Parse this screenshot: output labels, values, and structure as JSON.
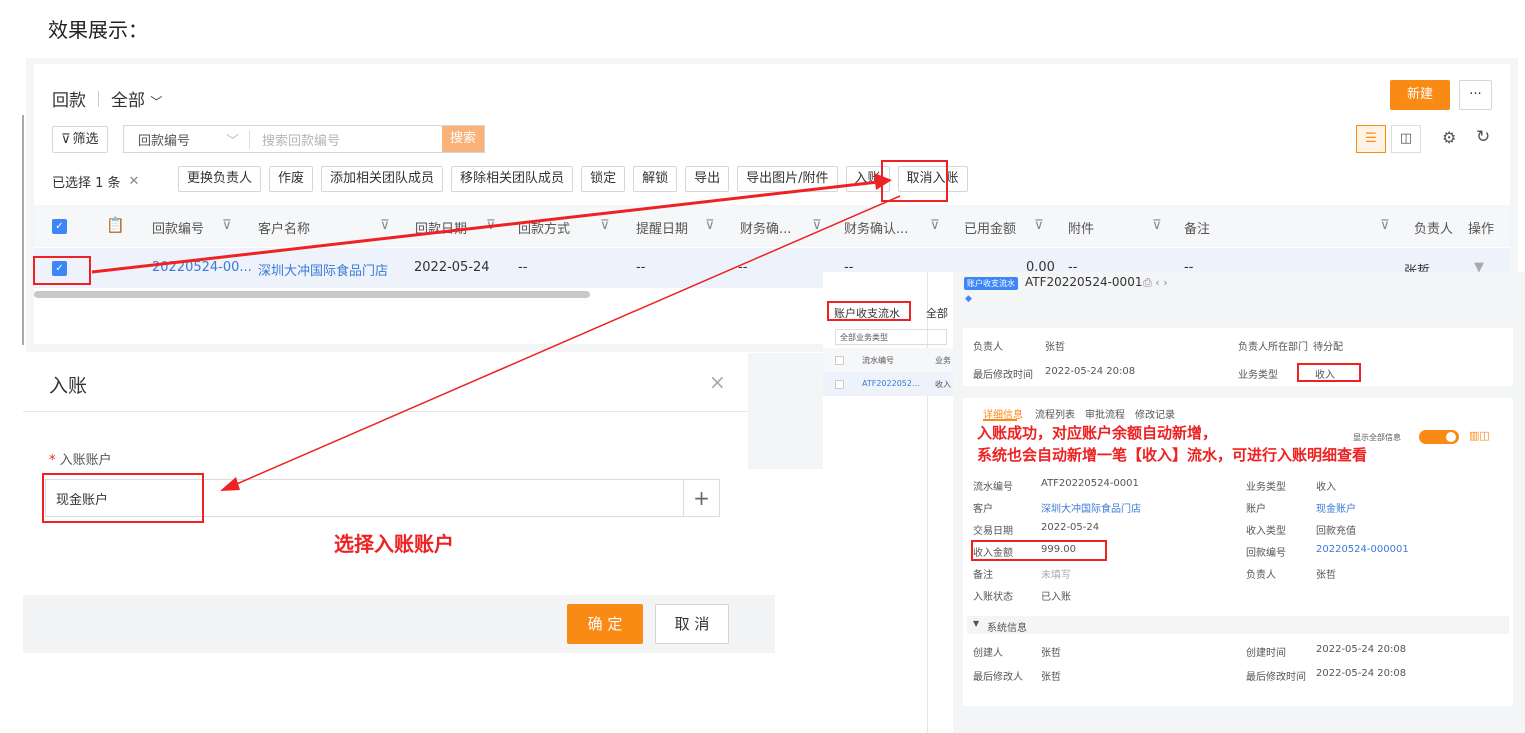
{
  "heading": "效果展示：",
  "list": {
    "title": "回款",
    "view": "全部",
    "new_button": "新建",
    "more_button": "···",
    "filter_button": "筛选",
    "search_field": "回款编号",
    "search_placeholder": "搜索回款编号",
    "search_button": "搜索",
    "selected_text": "已选择 1 条",
    "actions": [
      "更换负责人",
      "作废",
      "添加相关团队成员",
      "移除相关团队成员",
      "锁定",
      "解锁",
      "导出",
      "导出图片/附件",
      "入账",
      "取消入账"
    ],
    "columns": [
      "回款编号",
      "客户名称",
      "回款日期",
      "回款方式",
      "提醒日期",
      "财务确...",
      "财务确认...",
      "已用金额",
      "附件",
      "备注",
      "负责人",
      "操作"
    ],
    "row": {
      "code": "20220524-00...",
      "customer": "深圳大冲国际食品门店",
      "date": "2022-05-24",
      "method": "--",
      "remind": "--",
      "confirm1": "--",
      "confirm2": "--",
      "used": "0.00",
      "attach": "--",
      "note": "--",
      "owner": "张哲"
    }
  },
  "dialog": {
    "title": "入账",
    "close": "×",
    "required_mark": "*",
    "field_label": "入账账户",
    "field_value": "现金账户",
    "add_icon": "+",
    "ok": "确 定",
    "cancel": "取 消"
  },
  "annotation_select": "选择入账账户",
  "right": {
    "tab_label": "账户收支流水",
    "tab_all": "全部",
    "filter_type": "全部业务类型",
    "col_code": "流水编号",
    "col_type": "业务",
    "list_code": "ATF2022052...",
    "list_type": "收入",
    "badge": "账户收支流水",
    "record_no": "ATF20220524-0001",
    "owner_label": "负责人",
    "owner": "张哲",
    "dept_label": "负责人所在部门",
    "dept": "待分配",
    "modified_label": "最后修改时间",
    "modified": "2022-05-24 20:08",
    "biztype_label": "业务类型",
    "biztype": "收入",
    "tabs": [
      "详细信息",
      "流程列表",
      "审批流程",
      "修改记录"
    ],
    "show_all": "显示全部信息",
    "note_line1": "入账成功，对应账户余额自动新增，",
    "note_line2": "系统也会自动新增一笔【收入】流水，可进行入账明细查看",
    "fields_left": [
      {
        "k": "流水编号",
        "v": "ATF20220524-0001"
      },
      {
        "k": "客户",
        "v": "深圳大冲国际食品门店"
      },
      {
        "k": "交易日期",
        "v": "2022-05-24"
      },
      {
        "k": "收入金额",
        "v": "999.00"
      },
      {
        "k": "备注",
        "v": "未填写"
      },
      {
        "k": "入账状态",
        "v": "已入账"
      }
    ],
    "fields_right": [
      {
        "k": "业务类型",
        "v": "收入"
      },
      {
        "k": "账户",
        "v": "现金账户"
      },
      {
        "k": "收入类型",
        "v": "回款充值"
      },
      {
        "k": "回款编号",
        "v": "20220524-000001"
      },
      {
        "k": "负责人",
        "v": "张哲"
      }
    ],
    "sys_title": "系统信息",
    "creator_label": "创建人",
    "creator": "张哲",
    "created_label": "创建时间",
    "created": "2022-05-24 20:08",
    "modifier_label": "最后修改人",
    "modifier": "张哲",
    "modified2_label": "最后修改时间",
    "modified2": "2022-05-24 20:08"
  },
  "colors": {
    "accent": "#f98a14",
    "blue": "#3c86f5",
    "annotation": "#e22222",
    "arrow": "#f5a623"
  }
}
